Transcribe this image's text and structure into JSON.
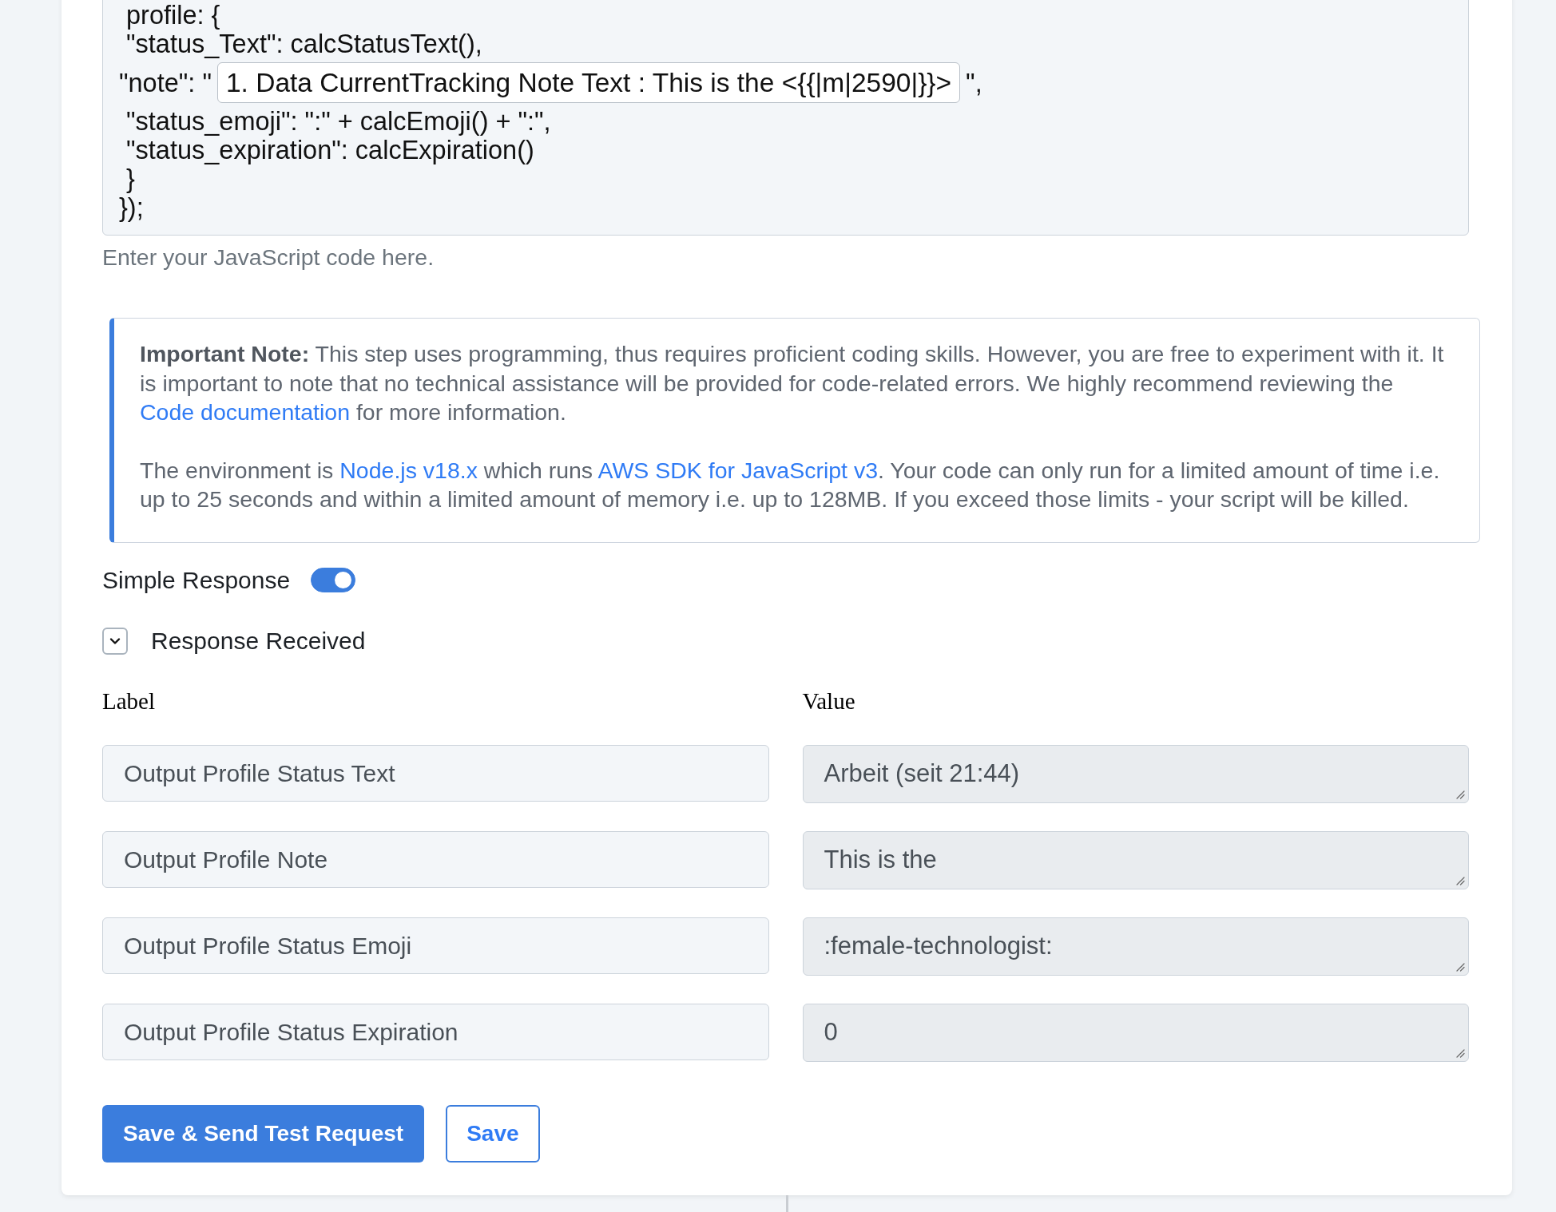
{
  "code_editor": {
    "lines": [
      {
        "kind": "code",
        "text": " profile: {"
      },
      {
        "kind": "code",
        "text": " \"status_Text\": calcStatusText(),"
      },
      {
        "kind": "field",
        "prefix": "\"note\": \"",
        "value": "1. Data CurrentTracking Note Text : This is the <{{|m|2590|}}>",
        "suffix": "\","
      },
      {
        "kind": "code",
        "text": " \"status_emoji\": \":\" + calcEmoji() + \":\","
      },
      {
        "kind": "code",
        "text": " \"status_expiration\": calcExpiration()"
      },
      {
        "kind": "code",
        "text": " }"
      },
      {
        "kind": "code",
        "text": "});"
      }
    ],
    "hint": "Enter your JavaScript code here."
  },
  "note": {
    "paragraphs": [
      [
        {
          "kind": "text",
          "text": "**Important Note:** This step uses programming, thus requires proficient coding skills. However, you are free to experiment with it. It is important to note that no technical assistance will be provided for code-related errors. We highly recommend reviewing the "
        },
        {
          "kind": "link",
          "text": "Code documentation"
        },
        {
          "kind": "text",
          "text": " for more information."
        }
      ],
      [
        {
          "kind": "text",
          "text": "The environment is "
        },
        {
          "kind": "link",
          "text": "Node.js v18.x"
        },
        {
          "kind": "text",
          "text": " which runs "
        },
        {
          "kind": "link",
          "text": "AWS SDK for JavaScript v3"
        },
        {
          "kind": "text",
          "text": ". Your code can only run for a limited amount of time i.e. up to 25 seconds and within a limited amount of memory i.e. up to 128MB. If you exceed those limits - your script will be killed."
        }
      ]
    ]
  },
  "simple_response": {
    "label": "Simple Response",
    "on": true
  },
  "response_received": {
    "label": "Response Received",
    "expanded": true
  },
  "mapping": {
    "columns": [
      "Label",
      "Value"
    ],
    "rows": [
      {
        "label": "Output Profile Status Text",
        "value": "Arbeit (seit 21:44)"
      },
      {
        "label": "Output Profile Note",
        "value": "This is the"
      },
      {
        "label": "Output Profile Status Emoji",
        "value": ":female-technologist:"
      },
      {
        "label": "Output Profile Status Expiration",
        "value": "0"
      }
    ]
  },
  "buttons": [
    {
      "kind": "primary",
      "label": "Save & Send Test Request"
    },
    {
      "kind": "outline",
      "label": "Save"
    }
  ]
}
